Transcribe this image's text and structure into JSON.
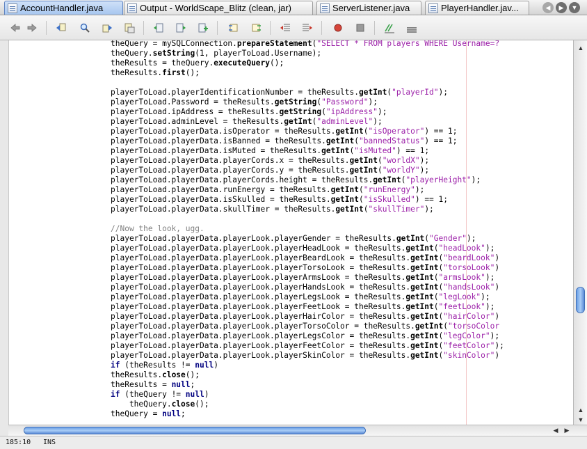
{
  "tabs": [
    {
      "label": "AccountHandler.java",
      "active": true
    },
    {
      "label": "Output - WorldScape_Blitz (clean, jar)",
      "active": false
    },
    {
      "label": "ServerListener.java",
      "active": false
    },
    {
      "label": "PlayerHandler.jav...",
      "active": false
    }
  ],
  "tab_nav": {
    "prev_icon": "◀",
    "next_icon": "▶",
    "menu_icon": "▼"
  },
  "toolbar_icons": [
    "back-icon",
    "forward-icon",
    "find-previous-icon",
    "find-icon",
    "find-next-icon",
    "find-selection-icon",
    "previous-bookmark-icon",
    "next-bookmark-icon",
    "toggle-bookmark-icon",
    "previous-match-icon",
    "next-match-icon",
    "shift-left-icon",
    "shift-right-icon",
    "start-macro-icon",
    "stop-macro-icon",
    "comment-icon",
    "uncomment-icon"
  ],
  "colors": {
    "keyword": "#000080",
    "string": "#9b1fa8",
    "comment": "#808080",
    "scroll_thumb": "#6a9ee6"
  },
  "code_lines": [
    [
      [
        "p",
        "theQuery = mySQLConnection."
      ],
      [
        "m",
        "prepareStatement"
      ],
      [
        "p",
        "("
      ],
      [
        "s",
        "\"SELECT * FROM players WHERE Username=?"
      ]
    ],
    [
      [
        "p",
        "theQuery."
      ],
      [
        "m",
        "setString"
      ],
      [
        "p",
        "(1, playerToLoad.Username);"
      ]
    ],
    [
      [
        "p",
        "theResults = theQuery."
      ],
      [
        "m",
        "executeQuery"
      ],
      [
        "p",
        "();"
      ]
    ],
    [
      [
        "p",
        "theResults."
      ],
      [
        "m",
        "first"
      ],
      [
        "p",
        "();"
      ]
    ],
    [],
    [
      [
        "p",
        "playerToLoad.playerIdentificationNumber = theResults."
      ],
      [
        "m",
        "getInt"
      ],
      [
        "p",
        "("
      ],
      [
        "s",
        "\"playerId\""
      ],
      [
        "p",
        ");"
      ]
    ],
    [
      [
        "p",
        "playerToLoad.Password = theResults."
      ],
      [
        "m",
        "getString"
      ],
      [
        "p",
        "("
      ],
      [
        "s",
        "\"Password\""
      ],
      [
        "p",
        ");"
      ]
    ],
    [
      [
        "p",
        "playerToLoad.ipAddress = theResults."
      ],
      [
        "m",
        "getString"
      ],
      [
        "p",
        "("
      ],
      [
        "s",
        "\"ipAddress\""
      ],
      [
        "p",
        ");"
      ]
    ],
    [
      [
        "p",
        "playerToLoad.adminLevel = theResults."
      ],
      [
        "m",
        "getInt"
      ],
      [
        "p",
        "("
      ],
      [
        "s",
        "\"adminLevel\""
      ],
      [
        "p",
        ");"
      ]
    ],
    [
      [
        "p",
        "playerToLoad.playerData.isOperator = theResults."
      ],
      [
        "m",
        "getInt"
      ],
      [
        "p",
        "("
      ],
      [
        "s",
        "\"isOperator\""
      ],
      [
        "p",
        ") == 1;"
      ]
    ],
    [
      [
        "p",
        "playerToLoad.playerData.isBanned = theResults."
      ],
      [
        "m",
        "getInt"
      ],
      [
        "p",
        "("
      ],
      [
        "s",
        "\"bannedStatus\""
      ],
      [
        "p",
        ") == 1;"
      ]
    ],
    [
      [
        "p",
        "playerToLoad.playerData.isMuted = theResults."
      ],
      [
        "m",
        "getInt"
      ],
      [
        "p",
        "("
      ],
      [
        "s",
        "\"isMuted\""
      ],
      [
        "p",
        ") == 1;"
      ]
    ],
    [
      [
        "p",
        "playerToLoad.playerData.playerCords.x = theResults."
      ],
      [
        "m",
        "getInt"
      ],
      [
        "p",
        "("
      ],
      [
        "s",
        "\"worldX\""
      ],
      [
        "p",
        ");"
      ]
    ],
    [
      [
        "p",
        "playerToLoad.playerData.playerCords.y = theResults."
      ],
      [
        "m",
        "getInt"
      ],
      [
        "p",
        "("
      ],
      [
        "s",
        "\"worldY\""
      ],
      [
        "p",
        ");"
      ]
    ],
    [
      [
        "p",
        "playerToLoad.playerData.playerCords.height = theResults."
      ],
      [
        "m",
        "getInt"
      ],
      [
        "p",
        "("
      ],
      [
        "s",
        "\"playerHeight\""
      ],
      [
        "p",
        ");"
      ]
    ],
    [
      [
        "p",
        "playerToLoad.playerData.runEnergy = theResults."
      ],
      [
        "m",
        "getInt"
      ],
      [
        "p",
        "("
      ],
      [
        "s",
        "\"runEnergy\""
      ],
      [
        "p",
        ");"
      ]
    ],
    [
      [
        "p",
        "playerToLoad.playerData.isSkulled = theResults."
      ],
      [
        "m",
        "getInt"
      ],
      [
        "p",
        "("
      ],
      [
        "s",
        "\"isSkulled\""
      ],
      [
        "p",
        ") == 1;"
      ]
    ],
    [
      [
        "p",
        "playerToLoad.playerData.skullTimer = theResults."
      ],
      [
        "m",
        "getInt"
      ],
      [
        "p",
        "("
      ],
      [
        "s",
        "\"skullTimer\""
      ],
      [
        "p",
        ");"
      ]
    ],
    [],
    [
      [
        "c",
        "//Now the look, ugg."
      ]
    ],
    [
      [
        "p",
        "playerToLoad.playerData.playerLook.playerGender = theResults."
      ],
      [
        "m",
        "getInt"
      ],
      [
        "p",
        "("
      ],
      [
        "s",
        "\"Gender\""
      ],
      [
        "p",
        ");"
      ]
    ],
    [
      [
        "p",
        "playerToLoad.playerData.playerLook.playerHeadLook = theResults."
      ],
      [
        "m",
        "getInt"
      ],
      [
        "p",
        "("
      ],
      [
        "s",
        "\"headLook\""
      ],
      [
        "p",
        ");"
      ]
    ],
    [
      [
        "p",
        "playerToLoad.playerData.playerLook.playerBeardLook = theResults."
      ],
      [
        "m",
        "getInt"
      ],
      [
        "p",
        "("
      ],
      [
        "s",
        "\"beardLook\""
      ],
      [
        "p",
        ")"
      ]
    ],
    [
      [
        "p",
        "playerToLoad.playerData.playerLook.playerTorsoLook = theResults."
      ],
      [
        "m",
        "getInt"
      ],
      [
        "p",
        "("
      ],
      [
        "s",
        "\"torsoLook\""
      ],
      [
        "p",
        ")"
      ]
    ],
    [
      [
        "p",
        "playerToLoad.playerData.playerLook.playerArmsLook = theResults."
      ],
      [
        "m",
        "getInt"
      ],
      [
        "p",
        "("
      ],
      [
        "s",
        "\"armsLook\""
      ],
      [
        "p",
        ");"
      ]
    ],
    [
      [
        "p",
        "playerToLoad.playerData.playerLook.playerHandsLook = theResults."
      ],
      [
        "m",
        "getInt"
      ],
      [
        "p",
        "("
      ],
      [
        "s",
        "\"handsLook\""
      ],
      [
        "p",
        ")"
      ]
    ],
    [
      [
        "p",
        "playerToLoad.playerData.playerLook.playerLegsLook = theResults."
      ],
      [
        "m",
        "getInt"
      ],
      [
        "p",
        "("
      ],
      [
        "s",
        "\"legLook\""
      ],
      [
        "p",
        ");"
      ]
    ],
    [
      [
        "p",
        "playerToLoad.playerData.playerLook.playerFeetLook = theResults."
      ],
      [
        "m",
        "getInt"
      ],
      [
        "p",
        "("
      ],
      [
        "s",
        "\"feetLook\""
      ],
      [
        "p",
        ");"
      ]
    ],
    [
      [
        "p",
        "playerToLoad.playerData.playerLook.playerHairColor = theResults."
      ],
      [
        "m",
        "getInt"
      ],
      [
        "p",
        "("
      ],
      [
        "s",
        "\"hairColor\""
      ],
      [
        "p",
        ")"
      ]
    ],
    [
      [
        "p",
        "playerToLoad.playerData.playerLook.playerTorsoColor = theResults."
      ],
      [
        "m",
        "getInt"
      ],
      [
        "p",
        "("
      ],
      [
        "s",
        "\"torsoColor"
      ]
    ],
    [
      [
        "p",
        "playerToLoad.playerData.playerLook.playerLegsColor = theResults."
      ],
      [
        "m",
        "getInt"
      ],
      [
        "p",
        "("
      ],
      [
        "s",
        "\"legColor\""
      ],
      [
        "p",
        ");"
      ]
    ],
    [
      [
        "p",
        "playerToLoad.playerData.playerLook.playerFeetColor = theResults."
      ],
      [
        "m",
        "getInt"
      ],
      [
        "p",
        "("
      ],
      [
        "s",
        "\"feetColor\""
      ],
      [
        "p",
        ");"
      ]
    ],
    [
      [
        "p",
        "playerToLoad.playerData.playerLook.playerSkinColor = theResults."
      ],
      [
        "m",
        "getInt"
      ],
      [
        "p",
        "("
      ],
      [
        "s",
        "\"skinColor\""
      ],
      [
        "p",
        ")"
      ]
    ],
    [
      [
        "k",
        "if"
      ],
      [
        "p",
        " (theResults != "
      ],
      [
        "k",
        "null"
      ],
      [
        "p",
        ")"
      ]
    ],
    [
      [
        "p",
        "theResults."
      ],
      [
        "m",
        "close"
      ],
      [
        "p",
        "();"
      ]
    ],
    [
      [
        "p",
        "theResults = "
      ],
      [
        "k",
        "null"
      ],
      [
        "p",
        ";"
      ]
    ],
    [
      [
        "k",
        "if"
      ],
      [
        "p",
        " (theQuery != "
      ],
      [
        "k",
        "null"
      ],
      [
        "p",
        ")"
      ]
    ],
    [
      [
        "p",
        "    theQuery."
      ],
      [
        "m",
        "close"
      ],
      [
        "p",
        "();"
      ]
    ],
    [
      [
        "p",
        "theQuery = "
      ],
      [
        "k",
        "null"
      ],
      [
        "p",
        ";"
      ]
    ]
  ],
  "scrollbars": {
    "vertical_position": 0.71,
    "horizontal_thumb_fraction": 0.6
  },
  "status": {
    "position": "185:10",
    "mode": "INS"
  }
}
